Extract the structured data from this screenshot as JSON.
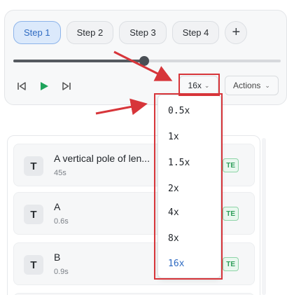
{
  "steps": [
    {
      "label": "Step 1",
      "active": true
    },
    {
      "label": "Step 2",
      "active": false
    },
    {
      "label": "Step 3",
      "active": false
    },
    {
      "label": "Step 4",
      "active": false
    }
  ],
  "add_step_label": "+",
  "timeline": {
    "progress": 0.49
  },
  "transport": {
    "prev_icon": "skip-back-icon",
    "play_icon": "play-icon",
    "next_icon": "skip-forward-icon"
  },
  "speed": {
    "current": "16x",
    "options": [
      "0.5x",
      "1x",
      "1.5x",
      "2x",
      "4x",
      "8x",
      "16x"
    ]
  },
  "actions_label": "Actions",
  "items": [
    {
      "icon_letter": "T",
      "title": "A vertical pole of len...",
      "subtitle": "45s",
      "badge": "TE"
    },
    {
      "icon_letter": "T",
      "title": "A",
      "subtitle": "0.6s",
      "badge": "TE"
    },
    {
      "icon_letter": "T",
      "title": "B",
      "subtitle": "0.9s",
      "badge": "TE"
    }
  ],
  "colors": {
    "accent": "#2f6bc2",
    "play": "#1fa35b",
    "highlight": "#d7353a",
    "badge": "#2f9e5b"
  }
}
